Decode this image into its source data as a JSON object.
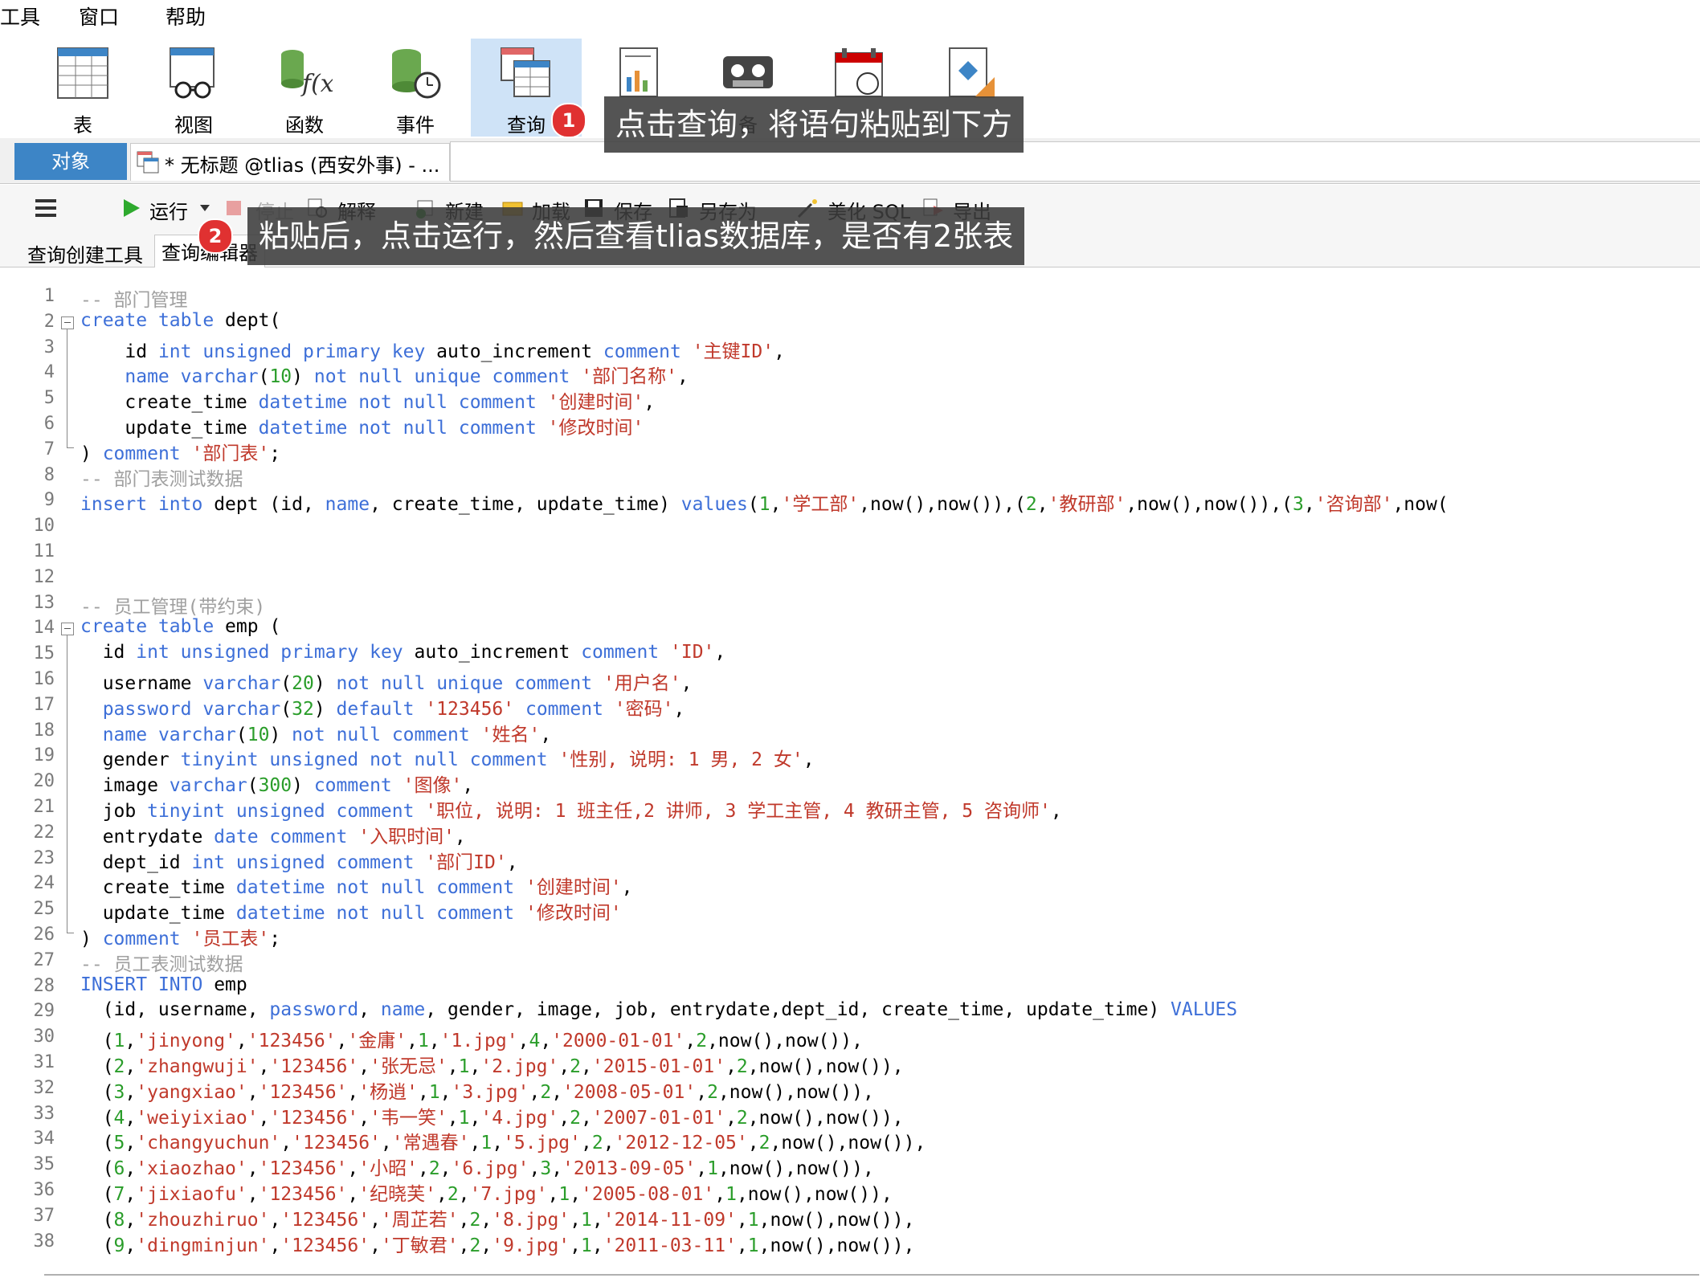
{
  "menu": [
    "工具",
    "窗口",
    "帮助"
  ],
  "ribbon": [
    {
      "label": "表",
      "icon": "table-icon"
    },
    {
      "label": "视图",
      "icon": "view-icon"
    },
    {
      "label": "函数",
      "icon": "function-icon"
    },
    {
      "label": "事件",
      "icon": "event-icon"
    },
    {
      "label": "查询",
      "icon": "query-icon",
      "active": true
    },
    {
      "label": "",
      "icon": "report-icon"
    },
    {
      "label": "备",
      "icon": "backup-icon"
    },
    {
      "label": "",
      "icon": "schedule-icon"
    },
    {
      "label": "",
      "icon": "model-icon"
    }
  ],
  "tabs": {
    "objects": "对象",
    "query_tab": "* 无标题 @tlias (西安外事) - ..."
  },
  "toolbar": {
    "run": "运行",
    "stop": "停止",
    "explain": "解释",
    "new": "新建",
    "load": "加载",
    "save": "保存",
    "save_as": "另存为",
    "beautify": "美化 SQL",
    "export": "导出"
  },
  "subtabs": [
    "查询创建工具",
    "查询编辑器"
  ],
  "annotations": [
    {
      "number": "1",
      "text": "点击查询，将语句粘贴到下方"
    },
    {
      "number": "2",
      "text": "粘贴后，点击运行，然后查看tlias数据库，是否有2张表"
    }
  ],
  "colors": {
    "keyword": "#3d6fd8",
    "string": "#c0392b",
    "number": "#2a9d2a",
    "comment": "#a0a0a0",
    "active_tab": "#3d85c6"
  },
  "code_lines": [
    "-- 部门管理",
    "create table dept(",
    "    id int unsigned primary key auto_increment comment '主键ID',",
    "    name varchar(10) not null unique comment '部门名称',",
    "    create_time datetime not null comment '创建时间',",
    "    update_time datetime not null comment '修改时间'",
    ") comment '部门表';",
    "-- 部门表测试数据",
    "insert into dept (id, name, create_time, update_time) values(1,'学工部',now(),now()),(2,'教研部',now(),now()),(3,'咨询部',now(",
    "",
    "",
    "",
    "-- 员工管理(带约束)",
    "create table emp (",
    "  id int unsigned primary key auto_increment comment 'ID',",
    "  username varchar(20) not null unique comment '用户名',",
    "  password varchar(32) default '123456' comment '密码',",
    "  name varchar(10) not null comment '姓名',",
    "  gender tinyint unsigned not null comment '性别, 说明: 1 男, 2 女',",
    "  image varchar(300) comment '图像',",
    "  job tinyint unsigned comment '职位, 说明: 1 班主任,2 讲师, 3 学工主管, 4 教研主管, 5 咨询师',",
    "  entrydate date comment '入职时间',",
    "  dept_id int unsigned comment '部门ID',",
    "  create_time datetime not null comment '创建时间',",
    "  update_time datetime not null comment '修改时间'",
    ") comment '员工表';",
    "-- 员工表测试数据",
    "INSERT INTO emp",
    "  (id, username, password, name, gender, image, job, entrydate,dept_id, create_time, update_time) VALUES",
    "  (1,'jinyong','123456','金庸',1,'1.jpg',4,'2000-01-01',2,now(),now()),",
    "  (2,'zhangwuji','123456','张无忌',1,'2.jpg',2,'2015-01-01',2,now(),now()),",
    "  (3,'yangxiao','123456','杨逍',1,'3.jpg',2,'2008-05-01',2,now(),now()),",
    "  (4,'weiyixiao','123456','韦一笑',1,'4.jpg',2,'2007-01-01',2,now(),now()),",
    "  (5,'changyuchun','123456','常遇春',1,'5.jpg',2,'2012-12-05',2,now(),now()),",
    "  (6,'xiaozhao','123456','小昭',2,'6.jpg',3,'2013-09-05',1,now(),now()),",
    "  (7,'jixiaofu','123456','纪晓芙',2,'7.jpg',1,'2005-08-01',1,now(),now()),",
    "  (8,'zhouzhiruo','123456','周芷若',2,'8.jpg',1,'2014-11-09',1,now(),now()),",
    "  (9,'dingminjun','123456','丁敏君',2,'9.jpg',1,'2011-03-11',1,now(),now()),"
  ]
}
